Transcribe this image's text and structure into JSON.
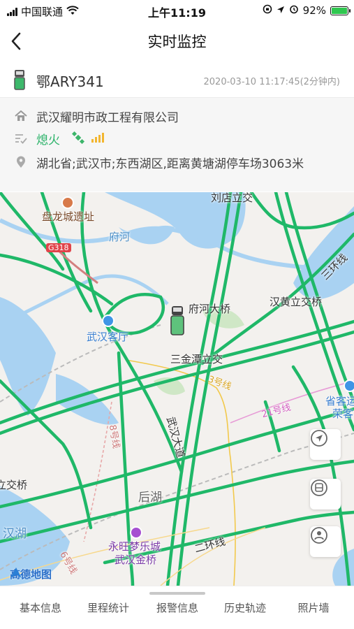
{
  "status_bar": {
    "carrier": "中国联通",
    "time": "上午11:19",
    "battery": "92%"
  },
  "nav": {
    "title": "实时监控"
  },
  "vehicle": {
    "plate": "鄂ARY341",
    "timestamp": "2020-03-10 11:17:45(2分钟内)"
  },
  "info": {
    "company": "武汉耀明市政工程有限公司",
    "engine_status": "熄火",
    "location": "湖北省;武汉市;东西湖区,距离黄塘湖停车场3063米"
  },
  "map": {
    "labels": {
      "liudian": "刘店立交",
      "panlong": "盘龙城遗址",
      "g318": "G318",
      "fuhe": "府河",
      "fuhe_bridge": "府河大桥",
      "hanhuang": "汉黄立交桥",
      "sanhuan": "三环线",
      "hankou_station": "武汉客厅",
      "sanjintan": "三金潭立交",
      "line3": "3号线",
      "line21": "21号线",
      "shengkeyun": "省客运",
      "rongkeyun": "荣客",
      "line8": "8号线",
      "wuhan_avenue": "武汉大道",
      "lijiao": "立交桥",
      "houhu": "后湖",
      "hanhu": "汉湖",
      "yongwang": "永旺梦乐城",
      "jinqiao": "武汉金桥",
      "erhuan": "二环线",
      "line6": "6号线",
      "logo": "高德地图"
    }
  },
  "tabs": [
    "基本信息",
    "里程统计",
    "报警信息",
    "历史轨迹",
    "照片墙"
  ]
}
